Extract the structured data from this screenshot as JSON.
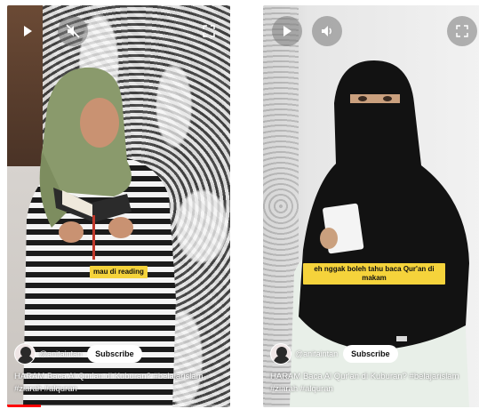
{
  "videos": [
    {
      "caption": "mau di reading",
      "author": "@anitaintan",
      "subscribe_label": "Subscribe",
      "title": "HARAM Baca Al Qur'an di Kuburan? #belajarislam #ziarah #alquran",
      "progress": 0.15,
      "controls": [
        "play-icon",
        "mute-icon",
        "fullscreen-icon"
      ]
    },
    {
      "caption": "eh nggak boleh tahu baca Qur'an di makam",
      "author": "@anitaintan",
      "subscribe_label": "Subscribe",
      "title": "HARAM Baca Al Qur'an di Kuburan? #belajarislam #ziarah #alquran",
      "progress": 0,
      "controls": [
        "play-icon",
        "volume-icon",
        "fullscreen-icon"
      ]
    }
  ],
  "colors": {
    "caption_bg": "#f5d33b",
    "progress": "#ff0000",
    "hijab_green": "#8a9a6c",
    "niqab_black": "#111111"
  }
}
